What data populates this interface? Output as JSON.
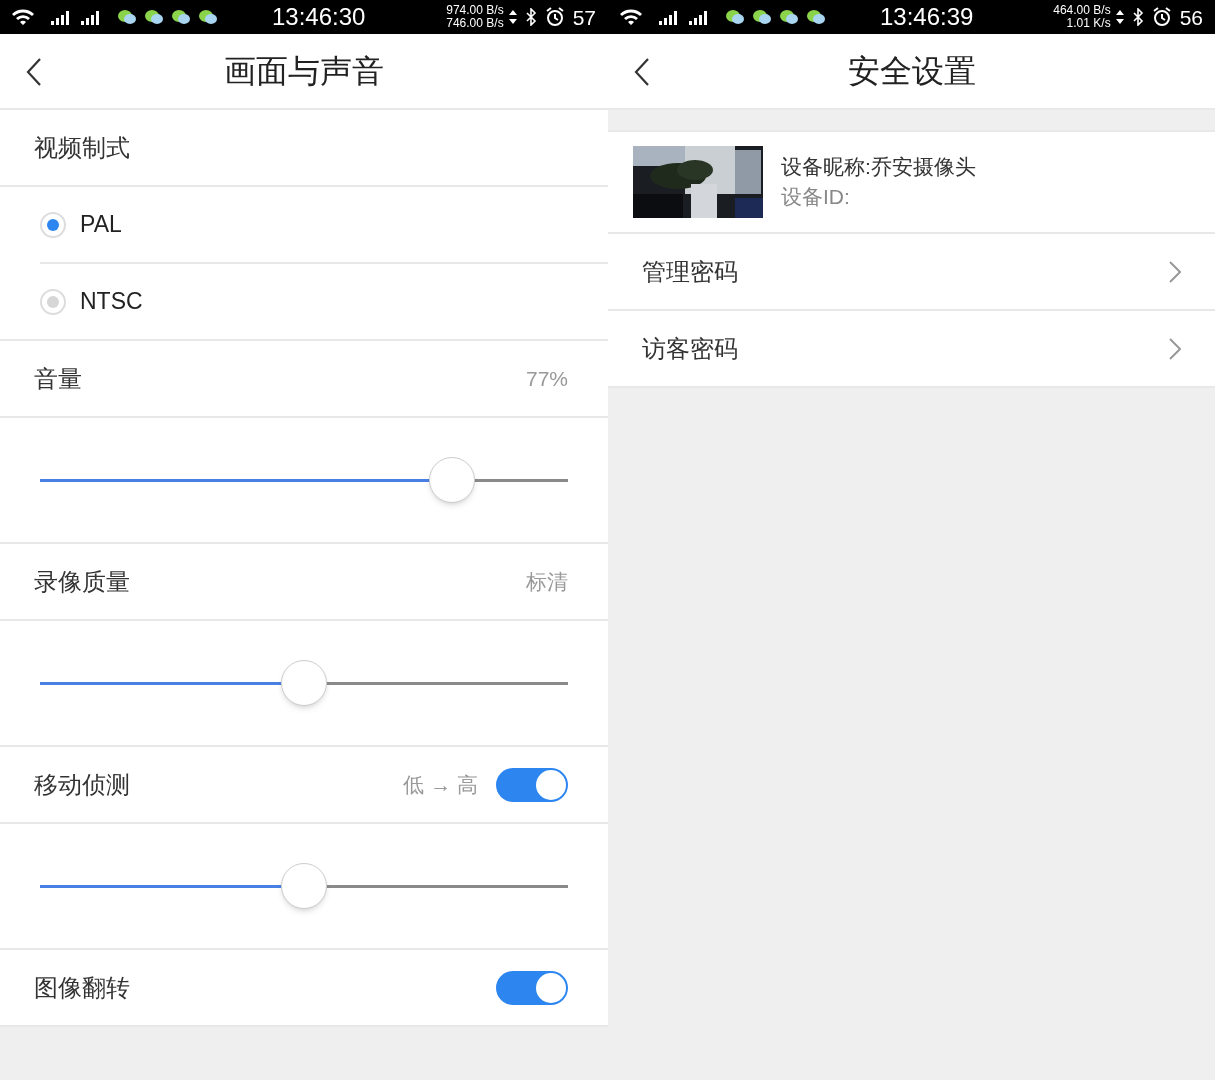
{
  "left": {
    "status_bar": {
      "time": "13:46:30",
      "upload": "974.00 B/s",
      "download": "746.00 B/s",
      "battery": "57"
    },
    "title": "画面与声音",
    "rows": [
      {
        "kind": "header",
        "label": "视频制式"
      },
      {
        "kind": "radio",
        "label": "PAL",
        "selected": true
      },
      {
        "kind": "radio",
        "label": "NTSC",
        "selected": false
      },
      {
        "kind": "value",
        "label": "音量",
        "value": "77%"
      },
      {
        "kind": "slider",
        "level": 0.78
      },
      {
        "kind": "value",
        "label": "录像质量",
        "value": "标清"
      },
      {
        "kind": "slider",
        "level": 0.5
      },
      {
        "kind": "toggle",
        "label": "移动侦测",
        "value": "低 → 高",
        "on": true
      },
      {
        "kind": "slider",
        "level": 0.5
      },
      {
        "kind": "toggle",
        "label": "图像翻转",
        "on": true
      }
    ]
  },
  "right": {
    "status_bar": {
      "time": "13:46:39",
      "upload": "464.00 B/s",
      "download": "1.01 K/s",
      "battery": "56"
    },
    "title": "安全设置",
    "device": {
      "kind": "picture",
      "name": "设备昵称:乔安摄像头",
      "id": "设备ID:"
    },
    "items": [
      {
        "label": "管理密码"
      },
      {
        "label": "访客密码"
      }
    ]
  }
}
